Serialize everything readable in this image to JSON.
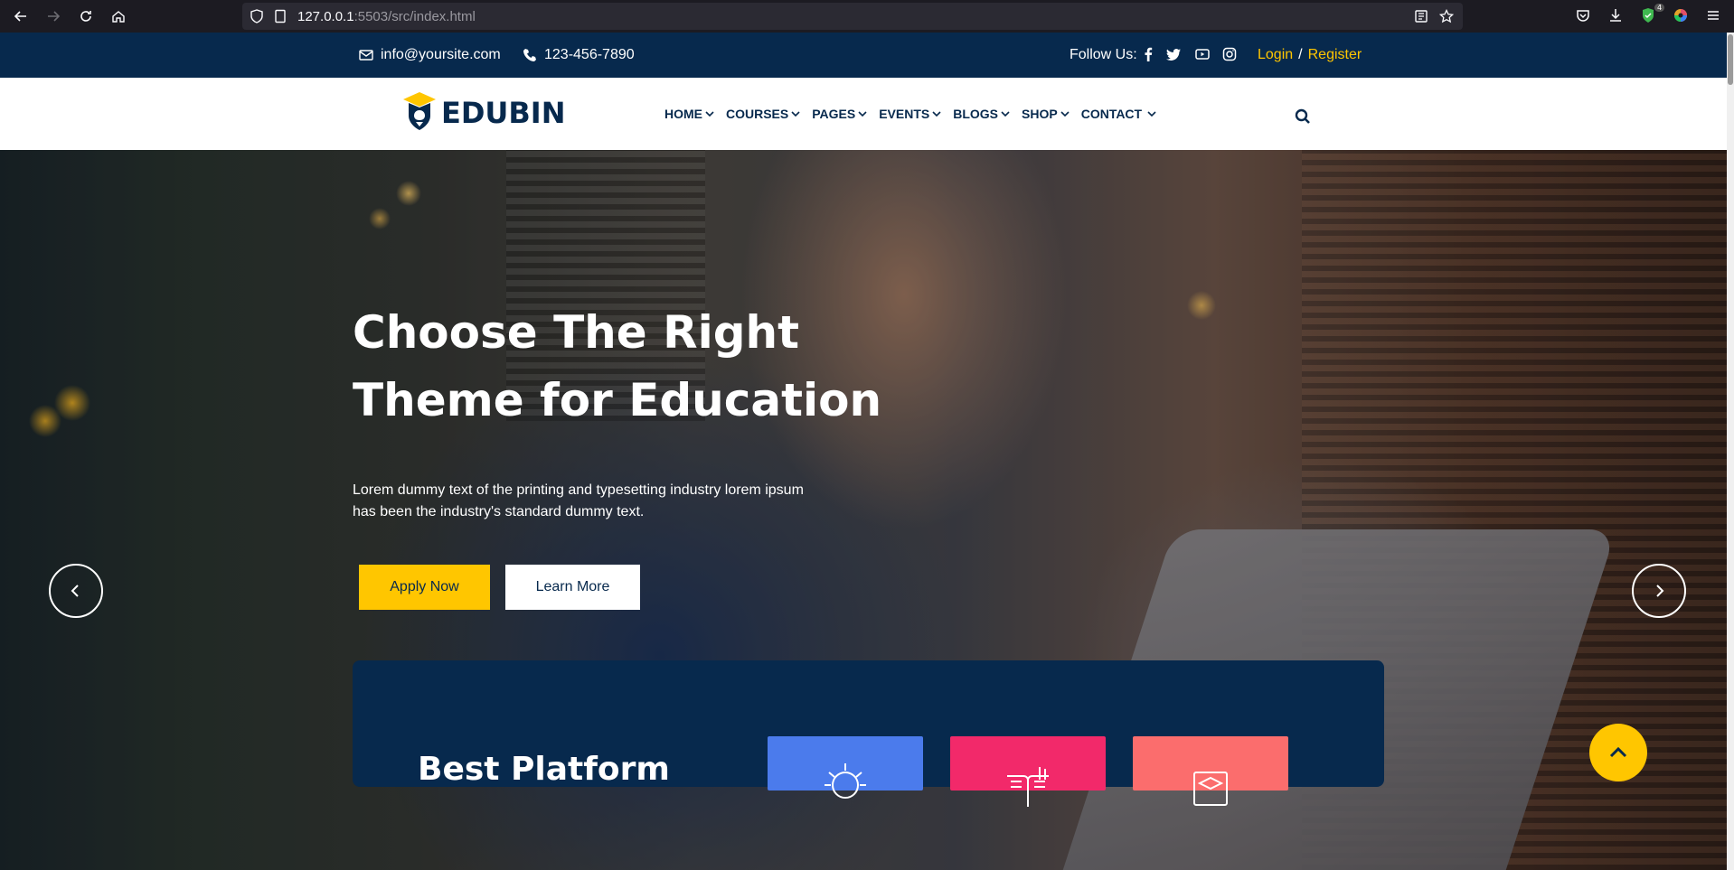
{
  "browser": {
    "url_host": "127.0.0.1",
    "url_rest": ":5503/src/index.html",
    "extension_badge": "4"
  },
  "topbar": {
    "email": "info@yoursite.com",
    "phone": "123-456-7890",
    "follow_label": "Follow Us:",
    "login": "Login",
    "slash": "/",
    "register": "Register",
    "social_icons": [
      "facebook-icon",
      "twitter-icon",
      "youtube-icon",
      "instagram-icon"
    ]
  },
  "header": {
    "logo_text": "EDUBIN",
    "menu": [
      {
        "label": "HOME"
      },
      {
        "label": "COURSES"
      },
      {
        "label": "PAGES"
      },
      {
        "label": "EVENTS"
      },
      {
        "label": "BLOGS"
      },
      {
        "label": "SHOP"
      },
      {
        "label": "CONTACT"
      }
    ]
  },
  "hero": {
    "title_line1": "Choose The Right",
    "title_line2": "Theme for Education",
    "desc_line1": "Lorem dummy text of the printing and typesetting industry lorem ipsum",
    "desc_line2": "has been the industry's standard dummy text.",
    "apply_label": "Apply Now",
    "learn_label": "Learn More"
  },
  "platform": {
    "title": "Best Platform",
    "cards": [
      {
        "icon": "lightbulb-icon",
        "color": "#4b7bec"
      },
      {
        "icon": "book-icon",
        "color": "#f2296a"
      },
      {
        "icon": "graduation-cap-icon",
        "color": "#fb6d6d"
      }
    ]
  },
  "colors": {
    "brand_navy": "#07294d",
    "accent_yellow": "#ffc600"
  }
}
